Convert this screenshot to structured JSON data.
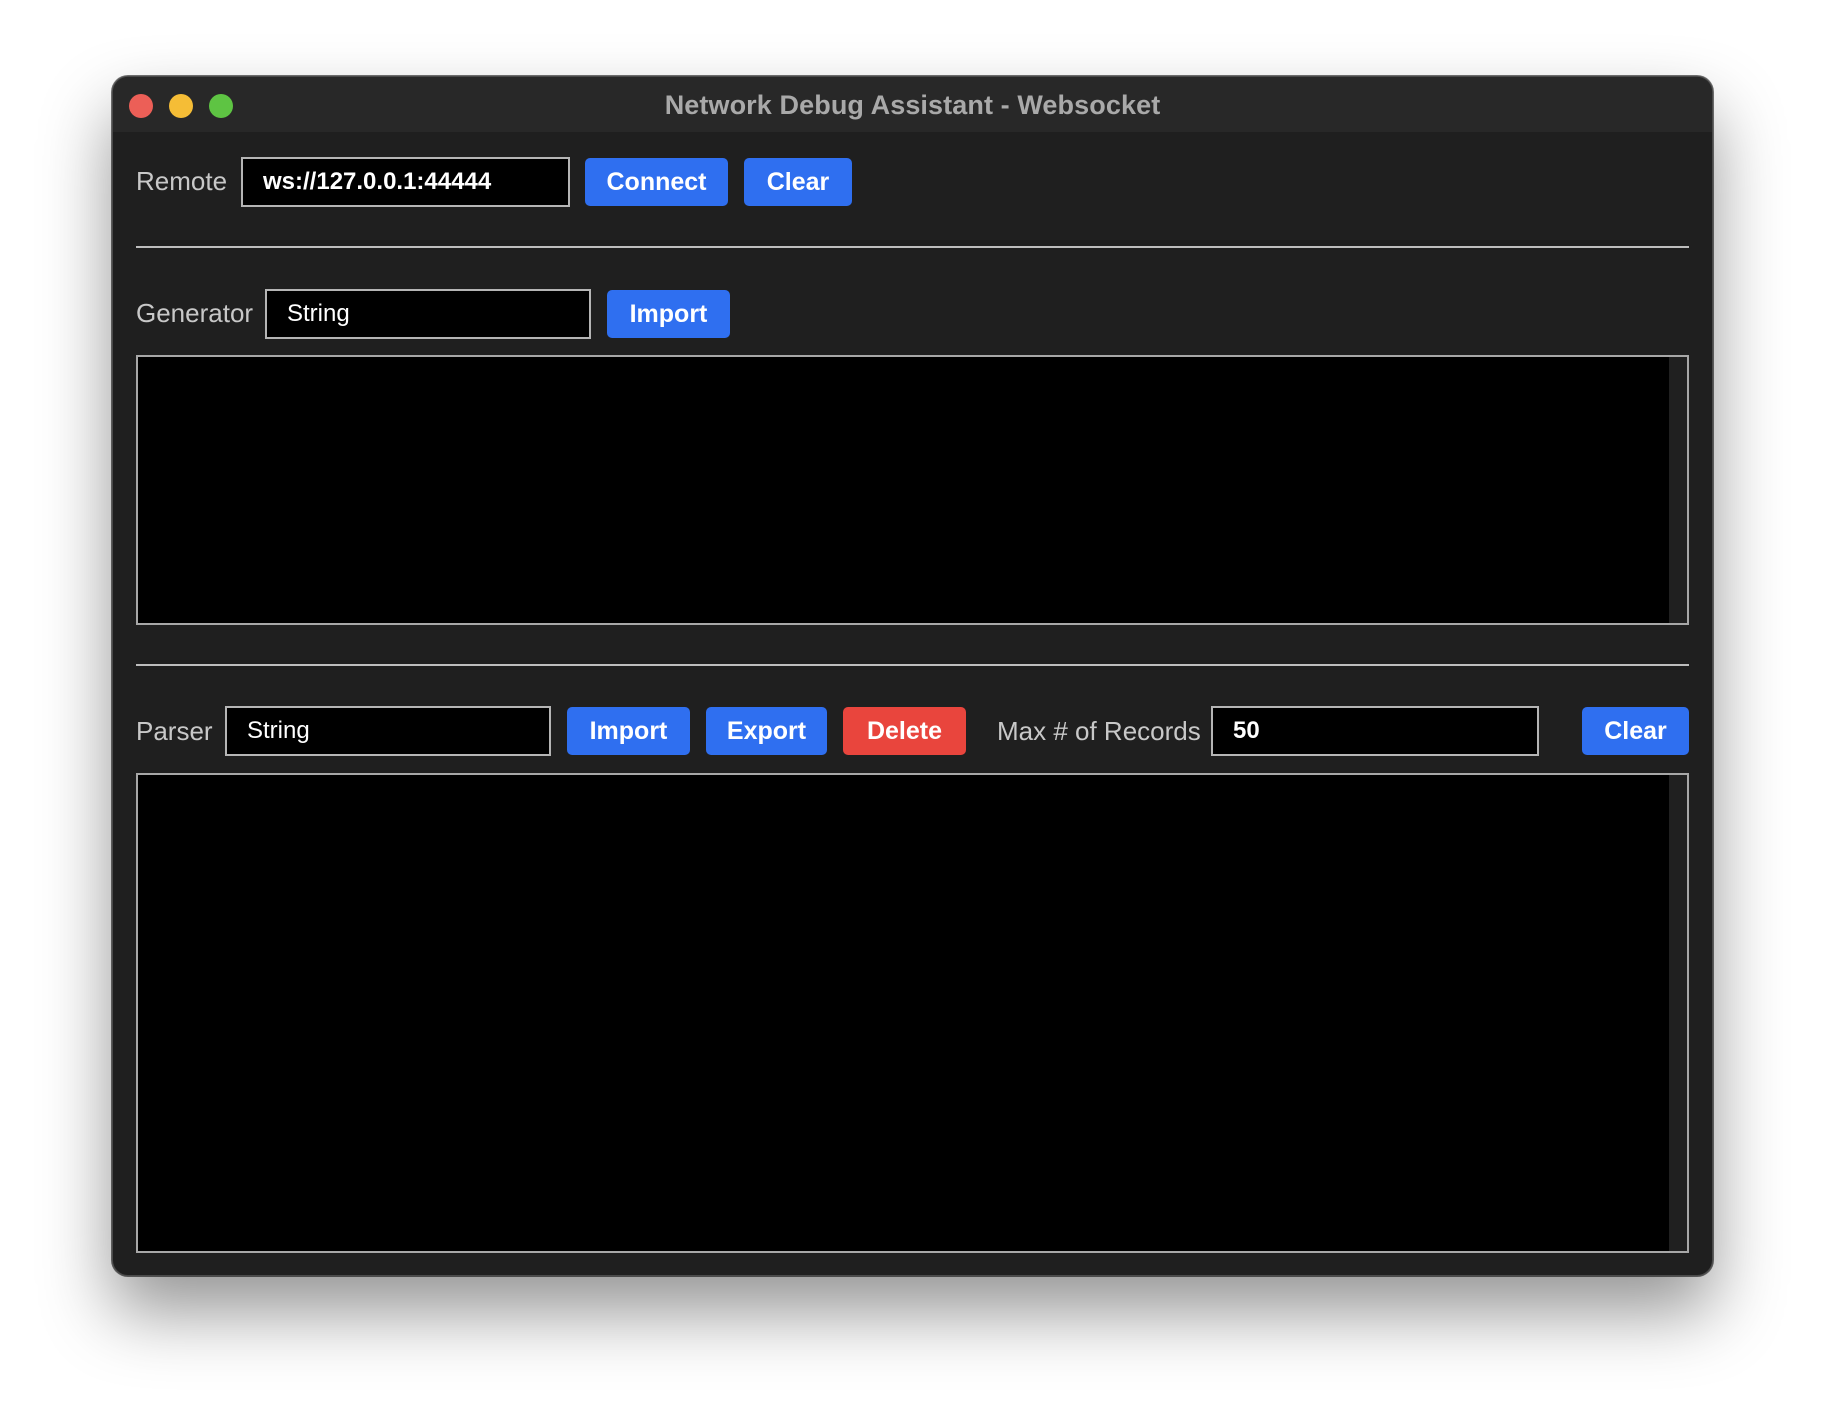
{
  "window": {
    "title": "Network Debug Assistant - Websocket"
  },
  "remote": {
    "label": "Remote",
    "value": "ws://127.0.0.1:44444",
    "connect_label": "Connect",
    "clear_label": "Clear"
  },
  "generator": {
    "label": "Generator",
    "value": "String",
    "import_label": "Import",
    "content": ""
  },
  "parser": {
    "label": "Parser",
    "value": "String",
    "import_label": "Import",
    "export_label": "Export",
    "delete_label": "Delete",
    "max_records_label": "Max # of Records",
    "max_records_value": "50",
    "clear_label": "Clear",
    "content": ""
  },
  "colors": {
    "accent": "#2f6ff0",
    "danger": "#e9453d",
    "window_bg": "#1f1f1f",
    "field_bg": "#000000"
  }
}
